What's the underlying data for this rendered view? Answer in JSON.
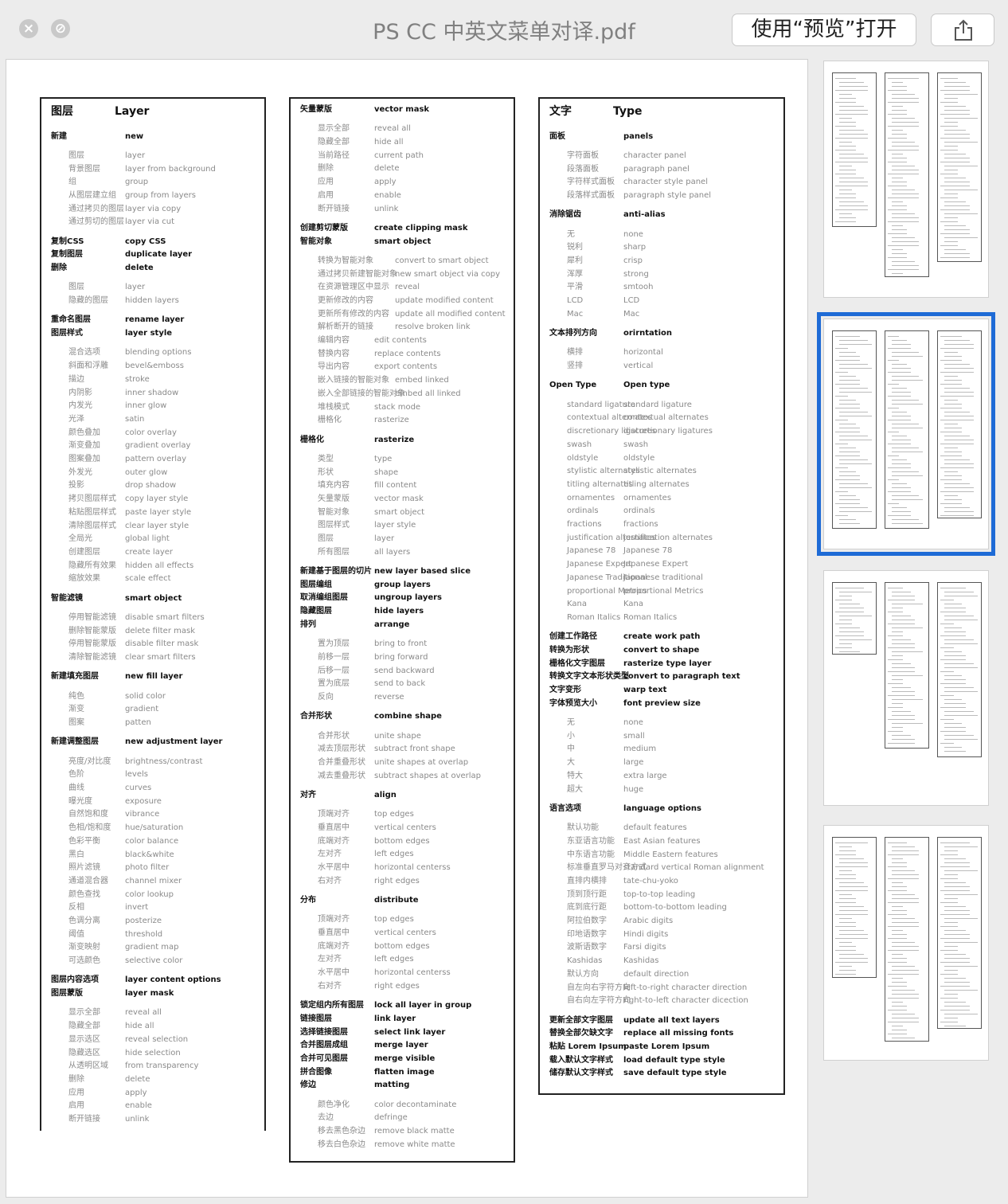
{
  "window": {
    "title": "PS CC 中英文菜单对译.pdf",
    "open_with_label": "使用“预览”打开",
    "close_icon": "close-icon",
    "minimize_icon": "minimize-icon",
    "share_icon": "share-icon"
  },
  "columns": [
    {
      "zhw": 93,
      "lines": [
        [
          "h",
          "图层",
          "Layer"
        ],
        [
          "b",
          "新建",
          "new"
        ],
        [
          "g",
          "图层",
          "layer"
        ],
        [
          "g",
          "背景图层",
          "layer from background"
        ],
        [
          "g",
          "组",
          "group"
        ],
        [
          "g",
          "从图层建立组",
          "group from layers"
        ],
        [
          "g",
          "通过拷贝的图层",
          "layer via copy"
        ],
        [
          "g",
          "通过剪切的图层",
          "layer via cut"
        ],
        [
          "b",
          "复制CSS",
          "copy CSS"
        ],
        [
          "b",
          "复制图层",
          "duplicate layer"
        ],
        [
          "b",
          "删除",
          "delete"
        ],
        [
          "g",
          "图层",
          "layer"
        ],
        [
          "g",
          "隐藏的图层",
          "hidden layers"
        ],
        [
          "b",
          "重命名图层",
          "rename layer"
        ],
        [
          "b",
          "图层样式",
          "layer style"
        ],
        [
          "g",
          "混合选项",
          "blending options"
        ],
        [
          "g",
          "斜面和浮雕",
          "bevel&emboss"
        ],
        [
          "g",
          "描边",
          "stroke"
        ],
        [
          "g",
          "内阴影",
          "inner shadow"
        ],
        [
          "g",
          "内发光",
          "inner glow"
        ],
        [
          "g",
          "光泽",
          "satin"
        ],
        [
          "g",
          "颜色叠加",
          "color overlay"
        ],
        [
          "g",
          "渐变叠加",
          "gradient overlay"
        ],
        [
          "g",
          "图案叠加",
          "pattern overlay"
        ],
        [
          "g",
          "外发光",
          "outer glow"
        ],
        [
          "g",
          "投影",
          "drop shadow"
        ],
        [
          "g",
          "拷贝图层样式",
          "copy layer style"
        ],
        [
          "g",
          "粘贴图层样式",
          "paste layer style"
        ],
        [
          "g",
          "清除图层样式",
          "clear layer style"
        ],
        [
          "g",
          "全局光",
          "global light"
        ],
        [
          "g",
          "创建图层",
          "create layer"
        ],
        [
          "g",
          "隐藏所有效果",
          "hidden all effects"
        ],
        [
          "g",
          "缩放效果",
          "scale effect"
        ],
        [
          "b",
          "智能滤镜",
          "smart object"
        ],
        [
          "g",
          "停用智能滤镜",
          "disable smart filters"
        ],
        [
          "g",
          "删除智能蒙版",
          "delete filter mask"
        ],
        [
          "g",
          "停用智能蒙版",
          "disable filter mask"
        ],
        [
          "g",
          "清除智能滤镜",
          "clear smart filters"
        ],
        [
          "b",
          "新建填充图层",
          "new fill layer"
        ],
        [
          "g",
          "纯色",
          "solid color"
        ],
        [
          "g",
          "渐变",
          "gradient"
        ],
        [
          "g",
          "图案",
          "patten"
        ],
        [
          "b",
          "新建调整图层",
          "new adjustment layer"
        ],
        [
          "g",
          "亮度/对比度",
          "brightness/contrast"
        ],
        [
          "g",
          "色阶",
          "levels"
        ],
        [
          "g",
          "曲线",
          "curves"
        ],
        [
          "g",
          "曝光度",
          "exposure"
        ],
        [
          "g",
          "自然饱和度",
          "vibrance"
        ],
        [
          "g",
          "色相/饱和度",
          "hue/saturation"
        ],
        [
          "g",
          "色彩平衡",
          "color balance"
        ],
        [
          "g",
          "黑白",
          "black&white"
        ],
        [
          "g",
          "照片滤镜",
          "photo filter"
        ],
        [
          "g",
          "通道混合器",
          "channel mixer"
        ],
        [
          "g",
          "颜色查找",
          "color lookup"
        ],
        [
          "g",
          "反相",
          "invert"
        ],
        [
          "g",
          "色调分离",
          "posterize"
        ],
        [
          "g",
          "阈值",
          "threshold"
        ],
        [
          "g",
          "渐变映射",
          "gradient map"
        ],
        [
          "g",
          "可选颜色",
          "selective color"
        ],
        [
          "b",
          "图层内容选项",
          "layer content options"
        ],
        [
          "b",
          "图层蒙版",
          "layer  mask"
        ],
        [
          "g",
          "显示全部",
          "reveal all"
        ],
        [
          "g",
          "隐藏全部",
          "hide all"
        ],
        [
          "g",
          "显示选区",
          "reveal selection"
        ],
        [
          "g",
          "隐藏选区",
          "hide selection"
        ],
        [
          "g",
          "从透明区域",
          "from transparency"
        ],
        [
          "g",
          "删除",
          "delete"
        ],
        [
          "g",
          "应用",
          "apply"
        ],
        [
          "g",
          "启用",
          "enable"
        ],
        [
          "g",
          "断开链接",
          "unlink"
        ]
      ]
    },
    {
      "zhw": 93,
      "lines": [
        [
          "b",
          "矢量蒙版",
          "vector mask"
        ],
        [
          "g",
          "显示全部",
          "reveal all"
        ],
        [
          "g",
          "隐藏全部",
          "hide all"
        ],
        [
          "g",
          "当前路径",
          "current path"
        ],
        [
          "g",
          "删除",
          "delete"
        ],
        [
          "g",
          "应用",
          "apply"
        ],
        [
          "g",
          "启用",
          "enable"
        ],
        [
          "g",
          "断开链接",
          "unlink"
        ],
        [
          "b",
          "创建剪切蒙版",
          "create clipping mask"
        ],
        [
          "b",
          "智能对象",
          "smart object"
        ],
        [
          "g",
          "转换为智能对象",
          "convert to smart object"
        ],
        [
          "g",
          "通过拷贝新建智能对象",
          "new smart object via copy"
        ],
        [
          "g",
          "在资源管理区中显示",
          "reveal"
        ],
        [
          "g",
          "更新修改的内容",
          "update modified content"
        ],
        [
          "g",
          "更新所有修改的内容",
          "update all modified content"
        ],
        [
          "g",
          "解析断开的链接",
          "resolve broken link"
        ],
        [
          "g",
          "编辑内容",
          "edit contents"
        ],
        [
          "g",
          "替换内容",
          "replace contents"
        ],
        [
          "g",
          "导出内容",
          "export contents"
        ],
        [
          "g",
          "嵌入链接的智能对象",
          "embed linked"
        ],
        [
          "g",
          "嵌入全部链接的智能对象",
          "embed all linked"
        ],
        [
          "g",
          "堆栈模式",
          "stack mode"
        ],
        [
          "g",
          "栅格化",
          "rasterize"
        ],
        [
          "b",
          "栅格化",
          "rasterize"
        ],
        [
          "g",
          "类型",
          "type"
        ],
        [
          "g",
          "形状",
          "shape"
        ],
        [
          "g",
          "填充内容",
          "fill content"
        ],
        [
          "g",
          "矢量蒙版",
          "vector mask"
        ],
        [
          "g",
          "智能对象",
          "smart object"
        ],
        [
          "g",
          "图层样式",
          "layer style"
        ],
        [
          "g",
          "图层",
          "layer"
        ],
        [
          "g",
          "所有图层",
          "all layers"
        ],
        [
          "b",
          "新建基于图层的切片",
          "new layer based  slice"
        ],
        [
          "b",
          "图层编组",
          "group layers"
        ],
        [
          "b",
          "取消编组图层",
          "ungroup layers"
        ],
        [
          "b",
          "隐藏图层",
          "hide layers"
        ],
        [
          "b",
          "排列",
          "arrange"
        ],
        [
          "g",
          "置为顶层",
          "bring to front"
        ],
        [
          "g",
          "前移一层",
          "bring forward"
        ],
        [
          "g",
          "后移一层",
          "send backward"
        ],
        [
          "g",
          "置为底层",
          "send to back"
        ],
        [
          "g",
          "反向",
          "reverse"
        ],
        [
          "b",
          "合并形状",
          "combine shape"
        ],
        [
          "g",
          "合并形状",
          "unite shape"
        ],
        [
          "g",
          "减去顶层形状",
          "subtract front shape"
        ],
        [
          "g",
          "合并重叠形状",
          "unite shapes at overlap"
        ],
        [
          "g",
          "减去重叠形状",
          "subtract shapes at overlap"
        ],
        [
          "b",
          "对齐",
          "align"
        ],
        [
          "g",
          "顶端对齐",
          "top edges"
        ],
        [
          "g",
          "垂直居中",
          "vertical centers"
        ],
        [
          "g",
          "底端对齐",
          "bottom edges"
        ],
        [
          "g",
          "左对齐",
          "left edges"
        ],
        [
          "g",
          "水平居中",
          "horizontal centerss"
        ],
        [
          "g",
          "右对齐",
          "right edges"
        ],
        [
          "b",
          "分布",
          "distribute"
        ],
        [
          "g",
          "顶端对齐",
          "top edges"
        ],
        [
          "g",
          "垂直居中",
          "vertical centers"
        ],
        [
          "g",
          "底端对齐",
          "bottom edges"
        ],
        [
          "g",
          "左对齐",
          "left edges"
        ],
        [
          "g",
          "水平居中",
          "horizontal centerss"
        ],
        [
          "g",
          "右对齐",
          "right edges"
        ],
        [
          "b",
          "锁定组内所有图层",
          "lock all layer in group"
        ],
        [
          "b",
          "链接图层",
          "link layer"
        ],
        [
          "b",
          "选择链接图层",
          "select link layer"
        ],
        [
          "b",
          "合并图层成组",
          "merge layer"
        ],
        [
          "b",
          "合并可见图层",
          "merge visible"
        ],
        [
          "b",
          "拼合图像",
          "flatten image"
        ],
        [
          "b",
          "修边",
          "matting"
        ],
        [
          "g",
          "颜色净化",
          "color decontaminate"
        ],
        [
          "g",
          "去边",
          "defringe"
        ],
        [
          "g",
          "移去黑色杂边",
          "remove black matte"
        ],
        [
          "g",
          "移去白色杂边",
          "remove white matte"
        ]
      ]
    },
    {
      "zhw": 93,
      "lines": [
        [
          "h",
          "文字",
          "Type"
        ],
        [
          "b",
          "面板",
          "panels"
        ],
        [
          "g",
          "字符面板",
          "character panel"
        ],
        [
          "g",
          "段落面板",
          "paragraph panel"
        ],
        [
          "g",
          "字符样式面板",
          "character style panel"
        ],
        [
          "g",
          "段落样式面板",
          "paragraph style panel"
        ],
        [
          "b",
          "消除锯齿",
          "anti-alias"
        ],
        [
          "g",
          "无",
          "none"
        ],
        [
          "g",
          "锐利",
          "sharp"
        ],
        [
          "g",
          "犀利",
          "crisp"
        ],
        [
          "g",
          "浑厚",
          "strong"
        ],
        [
          "g",
          "平滑",
          "smtooh"
        ],
        [
          "g",
          "LCD",
          "LCD"
        ],
        [
          "g",
          "Mac",
          "Mac"
        ],
        [
          "b",
          "文本排列方向",
          "orirntation"
        ],
        [
          "g",
          "横排",
          "horizontal"
        ],
        [
          "g",
          "竖排",
          "vertical"
        ],
        [
          "b",
          "Open Type",
          "Open type"
        ],
        [
          "g",
          "standard ligature",
          "standard ligature"
        ],
        [
          "g",
          "contextual alternates",
          "contextual alternates"
        ],
        [
          "g",
          "discretionary ligatures",
          "discretionary ligatures"
        ],
        [
          "g",
          "swash",
          "swash"
        ],
        [
          "g",
          "oldstyle",
          "oldstyle"
        ],
        [
          "g",
          "stylistic alternates",
          "stylistic alternates"
        ],
        [
          "g",
          "titling alternates",
          "titling alternates"
        ],
        [
          "g",
          "ornamentes",
          "ornamentes"
        ],
        [
          "g",
          "ordinals",
          "ordinals"
        ],
        [
          "g",
          "fractions",
          "fractions"
        ],
        [
          "g",
          "justification alternates",
          "justification alternates"
        ],
        [
          "g",
          "Japanese 78",
          "Japanese 78"
        ],
        [
          "g",
          "Japanese Expert",
          "Japanese Expert"
        ],
        [
          "g",
          "Japanese Traditional",
          "Japanese traditional"
        ],
        [
          "g",
          "proportional Metrics",
          "proportional Metrics"
        ],
        [
          "g",
          "Kana",
          "Kana"
        ],
        [
          "g",
          "Roman Italics",
          "Roman Italics"
        ],
        [
          "b",
          "创建工作路径",
          "create work path"
        ],
        [
          "b",
          "转换为形状",
          "convert to shape"
        ],
        [
          "b",
          "栅格化文字图层",
          "rasterize type layer"
        ],
        [
          "b",
          "转换文字文本形状类型",
          "convert to paragraph text"
        ],
        [
          "b",
          "文字变形",
          "warp text"
        ],
        [
          "b",
          "字体预览大小",
          "font preview size"
        ],
        [
          "g",
          "无",
          "none"
        ],
        [
          "g",
          "小",
          "small"
        ],
        [
          "g",
          "中",
          "medium"
        ],
        [
          "g",
          "大",
          "large"
        ],
        [
          "g",
          "特大",
          "extra large"
        ],
        [
          "g",
          "超大",
          "huge"
        ],
        [
          "b",
          "语言选项",
          "language options"
        ],
        [
          "g",
          "默认功能",
          "default features"
        ],
        [
          "g",
          "东亚语言功能",
          "East Asian features"
        ],
        [
          "g",
          "中东语言功能",
          "Middle Eastern features"
        ],
        [
          "g",
          "标准垂直罗马对齐方式",
          "standard vertical Roman alignment"
        ],
        [
          "g",
          "直排内横排",
          "tate-chu-yoko"
        ],
        [
          "g",
          "顶到顶行距",
          "top-to-top leading"
        ],
        [
          "g",
          "底到底行距",
          "bottom-to-bottom leading"
        ],
        [
          "g",
          "阿拉伯数字",
          "Arabic digits"
        ],
        [
          "g",
          "印地语数字",
          "Hindi digits"
        ],
        [
          "g",
          "波斯语数字",
          "Farsi digits"
        ],
        [
          "g",
          "Kashidas",
          "Kashidas"
        ],
        [
          "g",
          "默认方向",
          "default direction"
        ],
        [
          "g",
          "自左向右字符方向",
          "left-to-right character direction"
        ],
        [
          "g",
          "自右向左字符方向",
          "right-to-left character dicection"
        ],
        [
          "b",
          "更新全部文字图层",
          "update all text layers"
        ],
        [
          "b",
          "替换全部欠缺文字",
          "replace all missing fonts"
        ],
        [
          "b",
          "粘贴 Lorem Ipsum",
          "paste Lorem Ipsum"
        ],
        [
          "b",
          "载入默认文字样式",
          "load default type style"
        ],
        [
          "b",
          "储存默认文字样式",
          "save default type style"
        ]
      ]
    }
  ],
  "thumbnails": [
    {
      "label": "page-1",
      "selected": false
    },
    {
      "label": "page-2",
      "selected": true
    },
    {
      "label": "page-3",
      "selected": false
    },
    {
      "label": "page-4",
      "selected": false
    }
  ]
}
